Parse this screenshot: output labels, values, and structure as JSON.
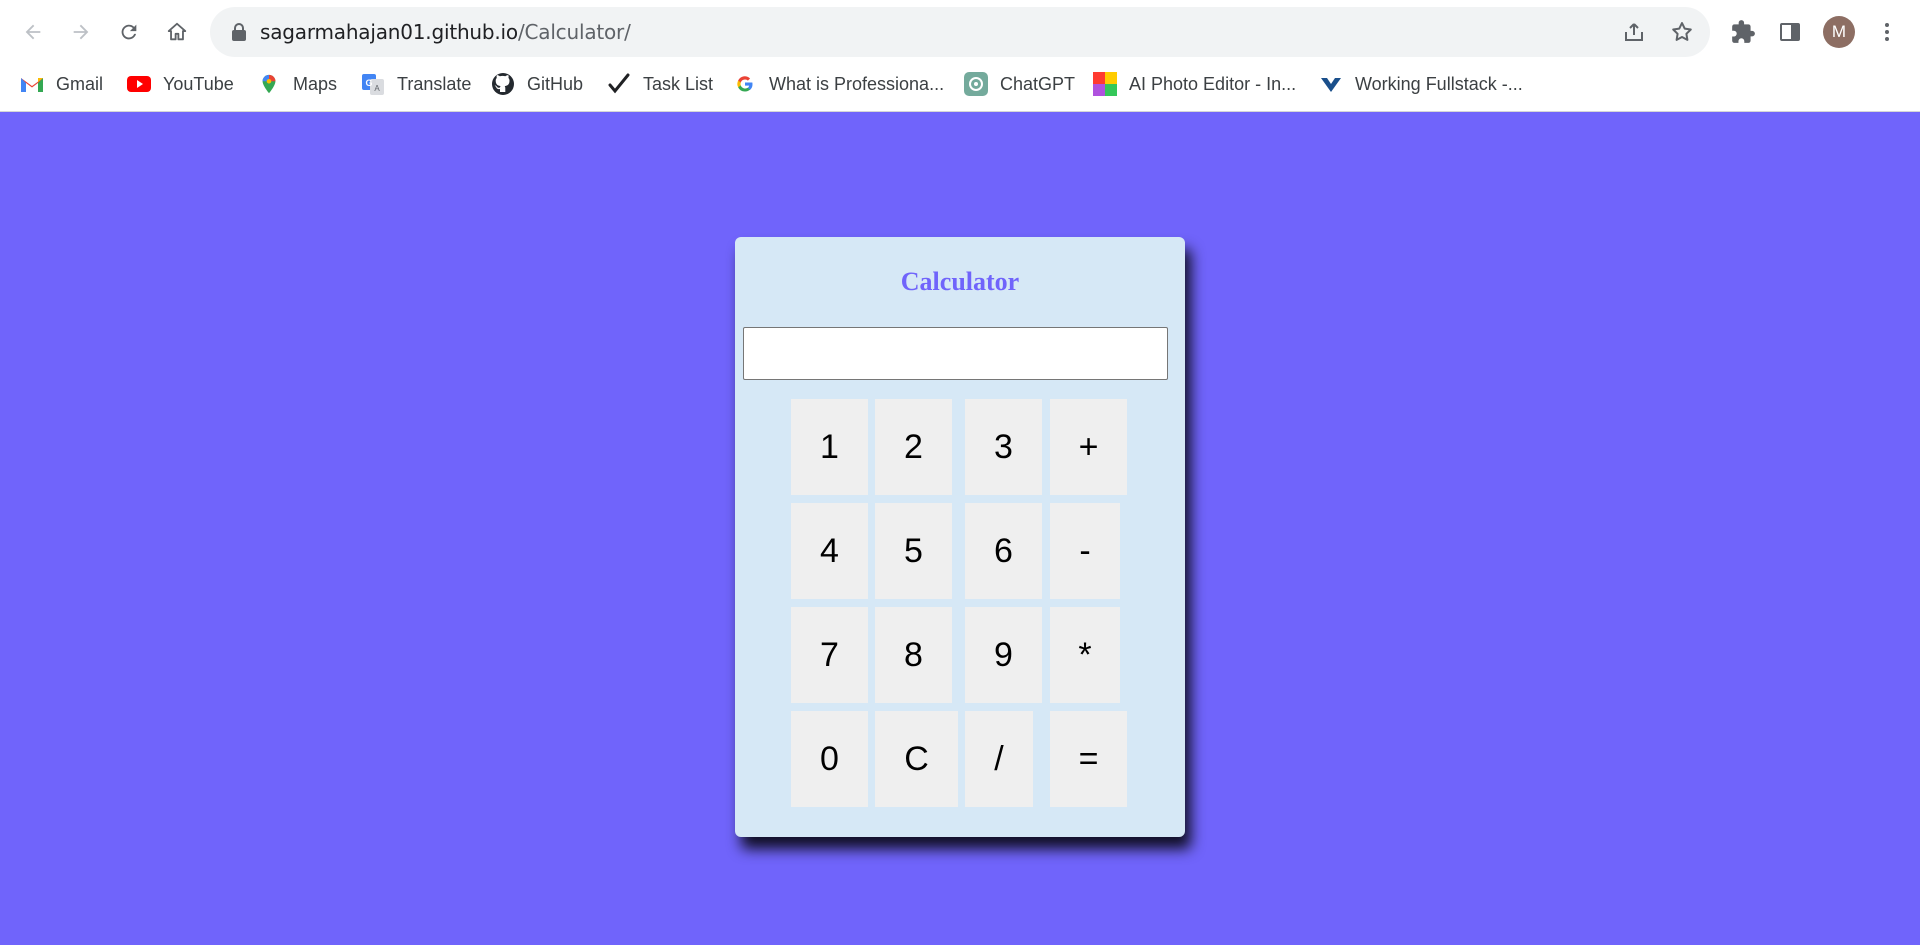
{
  "browser": {
    "url_host": "sagarmahajan01.github.io",
    "url_path": "/Calculator/",
    "profile_initial": "M",
    "bookmarks": [
      {
        "label": "Gmail",
        "icon": "gmail-icon"
      },
      {
        "label": "YouTube",
        "icon": "youtube-icon"
      },
      {
        "label": "Maps",
        "icon": "maps-icon"
      },
      {
        "label": "Translate",
        "icon": "translate-icon"
      },
      {
        "label": "GitHub",
        "icon": "github-icon"
      },
      {
        "label": "Task List",
        "icon": "checkmark-icon"
      },
      {
        "label": "What is Professiona...",
        "icon": "google-g-icon"
      },
      {
        "label": "ChatGPT",
        "icon": "chatgpt-icon"
      },
      {
        "label": "AI Photo Editor - In...",
        "icon": "photo-editor-icon"
      },
      {
        "label": "Working Fullstack -...",
        "icon": "fullstack-icon"
      }
    ]
  },
  "calculator": {
    "title": "Calculator",
    "display_value": "",
    "keys": [
      "1",
      "2",
      "3",
      "+",
      "4",
      "5",
      "6",
      "-",
      "7",
      "8",
      "9",
      "*",
      "0",
      "C",
      "/",
      "="
    ]
  },
  "colors": {
    "page_background": "#7064fb",
    "calculator_panel": "#d6e8f6",
    "title_text": "#7064fb",
    "key_background": "#efefef"
  }
}
